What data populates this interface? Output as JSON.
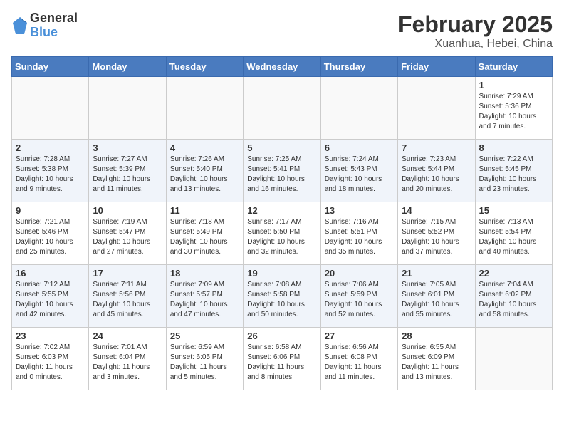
{
  "header": {
    "logo_general": "General",
    "logo_blue": "Blue",
    "month_year": "February 2025",
    "location": "Xuanhua, Hebei, China"
  },
  "days_of_week": [
    "Sunday",
    "Monday",
    "Tuesday",
    "Wednesday",
    "Thursday",
    "Friday",
    "Saturday"
  ],
  "weeks": [
    [
      {
        "day": "",
        "info": ""
      },
      {
        "day": "",
        "info": ""
      },
      {
        "day": "",
        "info": ""
      },
      {
        "day": "",
        "info": ""
      },
      {
        "day": "",
        "info": ""
      },
      {
        "day": "",
        "info": ""
      },
      {
        "day": "1",
        "info": "Sunrise: 7:29 AM\nSunset: 5:36 PM\nDaylight: 10 hours and 7 minutes."
      }
    ],
    [
      {
        "day": "2",
        "info": "Sunrise: 7:28 AM\nSunset: 5:38 PM\nDaylight: 10 hours and 9 minutes."
      },
      {
        "day": "3",
        "info": "Sunrise: 7:27 AM\nSunset: 5:39 PM\nDaylight: 10 hours and 11 minutes."
      },
      {
        "day": "4",
        "info": "Sunrise: 7:26 AM\nSunset: 5:40 PM\nDaylight: 10 hours and 13 minutes."
      },
      {
        "day": "5",
        "info": "Sunrise: 7:25 AM\nSunset: 5:41 PM\nDaylight: 10 hours and 16 minutes."
      },
      {
        "day": "6",
        "info": "Sunrise: 7:24 AM\nSunset: 5:43 PM\nDaylight: 10 hours and 18 minutes."
      },
      {
        "day": "7",
        "info": "Sunrise: 7:23 AM\nSunset: 5:44 PM\nDaylight: 10 hours and 20 minutes."
      },
      {
        "day": "8",
        "info": "Sunrise: 7:22 AM\nSunset: 5:45 PM\nDaylight: 10 hours and 23 minutes."
      }
    ],
    [
      {
        "day": "9",
        "info": "Sunrise: 7:21 AM\nSunset: 5:46 PM\nDaylight: 10 hours and 25 minutes."
      },
      {
        "day": "10",
        "info": "Sunrise: 7:19 AM\nSunset: 5:47 PM\nDaylight: 10 hours and 27 minutes."
      },
      {
        "day": "11",
        "info": "Sunrise: 7:18 AM\nSunset: 5:49 PM\nDaylight: 10 hours and 30 minutes."
      },
      {
        "day": "12",
        "info": "Sunrise: 7:17 AM\nSunset: 5:50 PM\nDaylight: 10 hours and 32 minutes."
      },
      {
        "day": "13",
        "info": "Sunrise: 7:16 AM\nSunset: 5:51 PM\nDaylight: 10 hours and 35 minutes."
      },
      {
        "day": "14",
        "info": "Sunrise: 7:15 AM\nSunset: 5:52 PM\nDaylight: 10 hours and 37 minutes."
      },
      {
        "day": "15",
        "info": "Sunrise: 7:13 AM\nSunset: 5:54 PM\nDaylight: 10 hours and 40 minutes."
      }
    ],
    [
      {
        "day": "16",
        "info": "Sunrise: 7:12 AM\nSunset: 5:55 PM\nDaylight: 10 hours and 42 minutes."
      },
      {
        "day": "17",
        "info": "Sunrise: 7:11 AM\nSunset: 5:56 PM\nDaylight: 10 hours and 45 minutes."
      },
      {
        "day": "18",
        "info": "Sunrise: 7:09 AM\nSunset: 5:57 PM\nDaylight: 10 hours and 47 minutes."
      },
      {
        "day": "19",
        "info": "Sunrise: 7:08 AM\nSunset: 5:58 PM\nDaylight: 10 hours and 50 minutes."
      },
      {
        "day": "20",
        "info": "Sunrise: 7:06 AM\nSunset: 5:59 PM\nDaylight: 10 hours and 52 minutes."
      },
      {
        "day": "21",
        "info": "Sunrise: 7:05 AM\nSunset: 6:01 PM\nDaylight: 10 hours and 55 minutes."
      },
      {
        "day": "22",
        "info": "Sunrise: 7:04 AM\nSunset: 6:02 PM\nDaylight: 10 hours and 58 minutes."
      }
    ],
    [
      {
        "day": "23",
        "info": "Sunrise: 7:02 AM\nSunset: 6:03 PM\nDaylight: 11 hours and 0 minutes."
      },
      {
        "day": "24",
        "info": "Sunrise: 7:01 AM\nSunset: 6:04 PM\nDaylight: 11 hours and 3 minutes."
      },
      {
        "day": "25",
        "info": "Sunrise: 6:59 AM\nSunset: 6:05 PM\nDaylight: 11 hours and 5 minutes."
      },
      {
        "day": "26",
        "info": "Sunrise: 6:58 AM\nSunset: 6:06 PM\nDaylight: 11 hours and 8 minutes."
      },
      {
        "day": "27",
        "info": "Sunrise: 6:56 AM\nSunset: 6:08 PM\nDaylight: 11 hours and 11 minutes."
      },
      {
        "day": "28",
        "info": "Sunrise: 6:55 AM\nSunset: 6:09 PM\nDaylight: 11 hours and 13 minutes."
      },
      {
        "day": "",
        "info": ""
      }
    ]
  ]
}
